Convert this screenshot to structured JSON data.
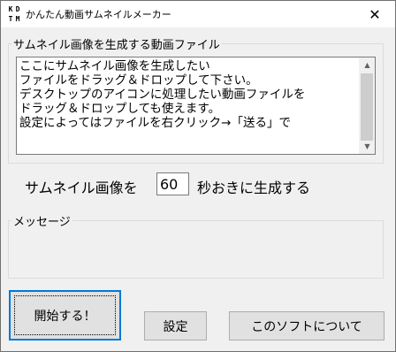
{
  "titlebar": {
    "icon_letters": [
      "K",
      "D",
      "T",
      "M"
    ],
    "title": "かんたん動画サムネイルメーカー",
    "close_symbol": "✕"
  },
  "thumb_group": {
    "label": "サムネイル画像を生成する動画ファイル",
    "lines": [
      "ここにサムネイル画像を生成したい",
      "ファイルをドラッグ＆ドロップして下さい。",
      "デスクトップのアイコンに処理したい動画ファイルを",
      "ドラッグ＆ドロップしても使えます。",
      "設定によってはファイルを右クリック→「送る」で"
    ]
  },
  "interval": {
    "prefix": "サムネイル画像を",
    "value": "60",
    "suffix": "秒おきに生成する"
  },
  "message_group": {
    "label": "メッセージ"
  },
  "buttons": {
    "start": "開始する！",
    "settings": "設定",
    "about": "このソフトについて"
  }
}
